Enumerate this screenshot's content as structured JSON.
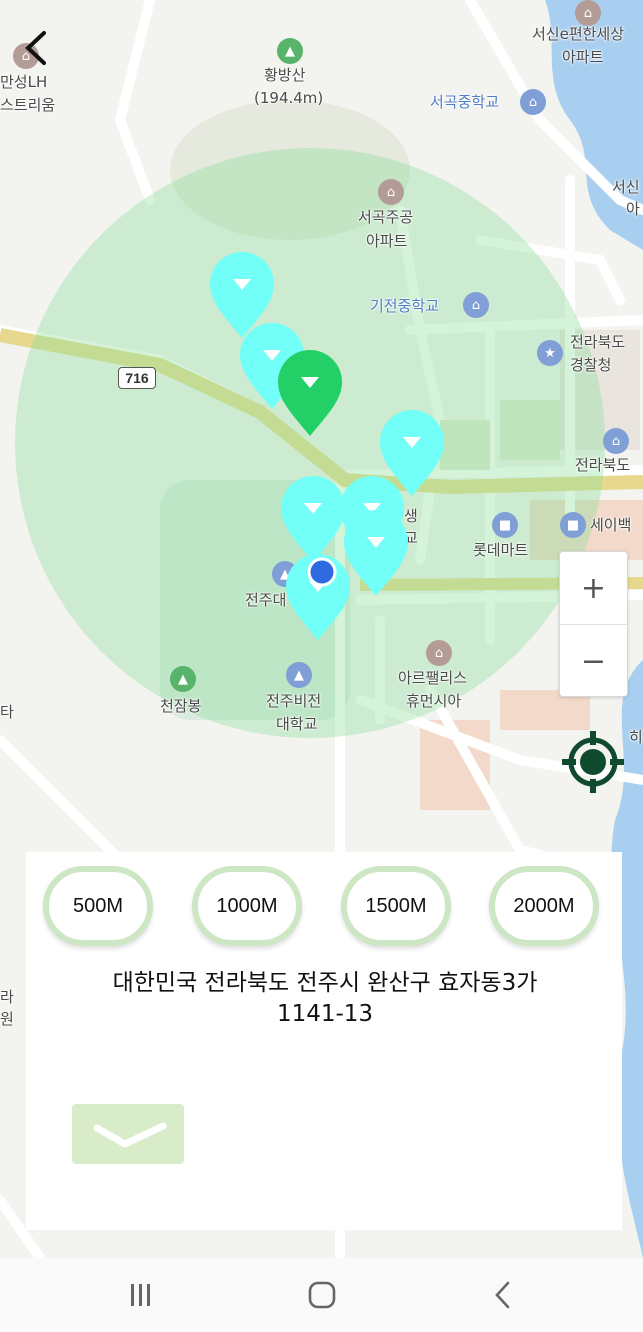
{
  "map": {
    "road_shield": "716",
    "labels": {
      "hwangbangsan": "황방산",
      "hwangbangsan_elev": "(194.4m)",
      "manseong_1": "만성LH",
      "manseong_2": "스트리움",
      "seogok_school": "서곡중학교",
      "seoshin_1": "서신e편한세상",
      "seoshin_2": "아파트",
      "seoshin2_1": "서신",
      "seoshin2_2": "아",
      "seogok_apt_1": "서곡주공",
      "seogok_apt_2": "아파트",
      "gijeon_school": "기전중학교",
      "police_1": "전라북도",
      "police_2": "경찰청",
      "province_office": "전라북도",
      "lotte_mart": "롯데마트",
      "sei_store": "세이백",
      "hyosaeng_1": "생",
      "hyosaeng_2": "교",
      "jeonju_uni": "전주대",
      "arc_palace_1": "아르팰리스",
      "arc_palace_2": "휴먼시아",
      "cheonjambong": "천잠봉",
      "vision_uni_1": "전주비전",
      "vision_uni_2": "대학교",
      "edge_ri": "히",
      "edge_left_1": "타",
      "edge_left_2": "라",
      "edge_left_3": "원"
    },
    "circle_color": "#8fe09a",
    "marker_color": "#72fff7",
    "selected_marker_color": "#22d067"
  },
  "controls": {
    "back_icon": "back-arrow-icon",
    "zoom_in": "+",
    "zoom_out": "−",
    "locate_icon": "crosshair-icon"
  },
  "radius_buttons": [
    "500M",
    "1000M",
    "1500M",
    "2000M"
  ],
  "address": {
    "line1": "대한민국 전라북도 전주시 완산구 효자동3가",
    "line2": "1141-13"
  },
  "confirm_icon": "checkmark-icon",
  "navbar": {
    "recent_icon": "recent-apps-icon",
    "home_icon": "home-icon",
    "back_icon": "nav-back-icon"
  }
}
